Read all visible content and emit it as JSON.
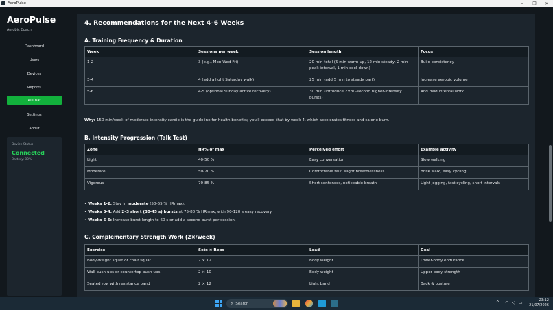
{
  "window": {
    "title": "AeroPulse",
    "controls": [
      "–",
      "❐",
      "✕"
    ]
  },
  "sidebar": {
    "brand": "AeroPulse",
    "subtitle": "Aerobic Coach",
    "items": [
      {
        "label": "Dashboard"
      },
      {
        "label": "Users"
      },
      {
        "label": "Devices"
      },
      {
        "label": "Reports"
      },
      {
        "label": "AI Chat",
        "active": true
      },
      {
        "label": "Settings"
      },
      {
        "label": "About"
      }
    ],
    "status": {
      "label": "Device Status",
      "value": "Connected",
      "battery": "Battery: 80%"
    }
  },
  "content": {
    "heading": "4. Recommendations for the Next 4–6 Weeks",
    "sectionA": {
      "title": "A. Training Frequency & Duration",
      "headers": [
        "Week",
        "Sessions per week",
        "Session length",
        "Focus"
      ],
      "rows": [
        [
          "1-2",
          "3 (e.g., Mon-Wed-Fri)",
          "20 min total (5 min warm-up, 12 min steady, 2 min peak interval, 1 min cool-down)",
          "Build consistency"
        ],
        [
          "3-4",
          "4 (add a light Saturday walk)",
          "25 min (add 5 min to steady part)",
          "Increase aerobic volume"
        ],
        [
          "5-6",
          "4-5 (optional Sunday active recovery)",
          "30 min (introduce 2×30-second higher-intensity bursts)",
          "Add mild interval work"
        ]
      ],
      "why_label": "Why:",
      "why_text": "150 min/week of moderate-intensity cardio is the guideline for health benefits; you'll exceed that by week 4, which accelerates fitness and calorie burn."
    },
    "sectionB": {
      "title": "B. Intensity Progression (Talk Test)",
      "headers": [
        "Zone",
        "HR% of max",
        "Perceived effort",
        "Example activity"
      ],
      "rows": [
        [
          "Light",
          "40-50 %",
          "Easy conversation",
          "Slow walking"
        ],
        [
          "Moderate",
          "50-70 %",
          "Comfortable talk, slight breathlessness",
          "Brisk walk, easy cycling"
        ],
        [
          "Vigorous",
          "70-85 %",
          "Short sentences, noticeable breath",
          "Light jogging, fast cycling, short intervals"
        ]
      ],
      "bullets": [
        {
          "lead": "Weeks 1-2:",
          "pre": "Stay in",
          "strong": "moderate",
          "post": "(50-65 % HRmax)."
        },
        {
          "lead": "Weeks 3-4:",
          "pre": "Add",
          "strong": "2–3 short (30-45 s) bursts",
          "post": "at 75-80 % HRmax, with 90-120 s easy recovery."
        },
        {
          "lead": "Weeks 5-6:",
          "pre": "Increase burst length to 60 s or add a second burst per session.",
          "strong": "",
          "post": ""
        }
      ]
    },
    "sectionC": {
      "title": "C. Complementary Strength Work (2×/week)",
      "headers": [
        "Exercise",
        "Sets × Reps",
        "Load",
        "Goal"
      ],
      "rows": [
        [
          "Body-weight squat or chair squat",
          "2 × 12",
          "Body weight",
          "Lower-body endurance"
        ],
        [
          "Wall push-ups or countertop push-ups",
          "2 × 10",
          "Body weight",
          "Upper-body strength"
        ],
        [
          "Seated row with resistance band",
          "2 × 12",
          "Light band",
          "Back & posture"
        ]
      ]
    }
  },
  "taskbar": {
    "search_label": "Search",
    "time": "23:12",
    "date": "21/07/2026",
    "tray_up": "^"
  },
  "colors": {
    "accent": "#12b03c",
    "connected": "#27d15a",
    "panel": "#1c252d",
    "background": "#12181d"
  }
}
